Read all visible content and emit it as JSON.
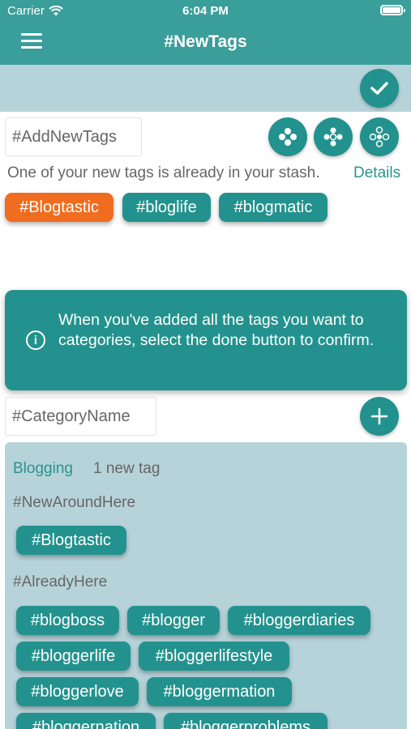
{
  "status_bar": {
    "carrier": "Carrier",
    "time": "6:04 PM"
  },
  "header": {
    "title": "#NewTags"
  },
  "inputs": {
    "new_tags_placeholder": "#AddNewTags",
    "category_placeholder": "#CategoryName"
  },
  "duplicate_notice": {
    "text": "One of your new tags is already in your stash.",
    "details_link": "Details"
  },
  "new_tags": [
    "#Blogtastic",
    "#bloglife",
    "#blogmatic"
  ],
  "info_message": "When you've added all the tags you want to categories, select the done button to confirm.",
  "category": {
    "name": "Blogging",
    "count_label": "1 new tag",
    "new_section_label": "#NewAroundHere",
    "new_tags": [
      "#Blogtastic"
    ],
    "existing_section_label": "#AlreadyHere",
    "existing_tags": [
      "#blogboss",
      "#blogger",
      "#bloggerdiaries",
      "#bloggerlife",
      "#bloggerlifestyle",
      "#bloggerlove",
      "#bloggermation",
      "#bloggernation",
      "#bloggerproblems"
    ]
  },
  "icons": {
    "menu": "hamburger-menu-icon",
    "done": "checkmark-icon",
    "actions": [
      "dice-four-icon",
      "dice-five-icon",
      "dice-six-icon"
    ],
    "add": "plus-icon",
    "info": "info-circle-icon"
  },
  "colors": {
    "header": "#3a9e9a",
    "primary": "#23928e",
    "highlight": "#f06c1e",
    "panel": "#b7d3da",
    "link": "#2a938f"
  }
}
